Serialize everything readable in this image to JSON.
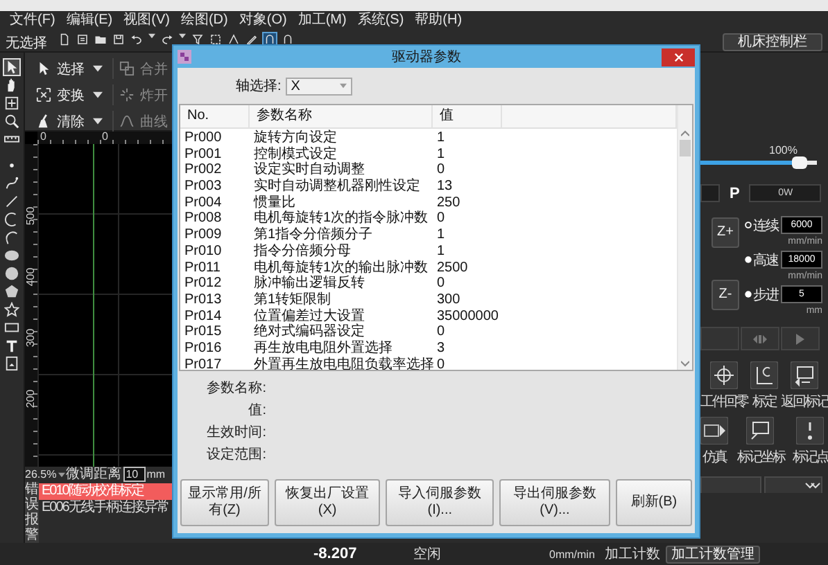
{
  "menu": [
    "文件(F)",
    "编辑(E)",
    "视图(V)",
    "绘图(D)",
    "对象(O)",
    "加工(M)",
    "系统(S)",
    "帮助(H)"
  ],
  "toolbar": {
    "selection": "无选择",
    "machine_panel_button": "机床控制栏"
  },
  "tools": [
    {
      "kind": "pointer",
      "selected": true
    },
    {
      "kind": "hand",
      "selected": false
    },
    {
      "kind": "fit",
      "selected": false
    },
    {
      "kind": "zoom",
      "selected": false
    },
    {
      "kind": "ruler",
      "selected": false
    },
    {
      "kind": "point",
      "selected": false
    },
    {
      "kind": "pen",
      "selected": false
    },
    {
      "kind": "line",
      "selected": false
    },
    {
      "kind": "arc",
      "selected": false
    },
    {
      "kind": "arc2",
      "selected": false
    },
    {
      "kind": "ellipse",
      "selected": false
    },
    {
      "kind": "circle",
      "selected": false
    },
    {
      "kind": "polygon",
      "selected": false
    },
    {
      "kind": "star",
      "selected": false
    },
    {
      "kind": "rect",
      "selected": false
    },
    {
      "kind": "text",
      "selected": false
    },
    {
      "kind": "image",
      "selected": false
    }
  ],
  "ribbon": [
    {
      "kind": "select",
      "label": "选择",
      "disabled": false
    },
    {
      "kind": "transform",
      "label": "变换",
      "disabled": false
    },
    {
      "kind": "clear",
      "label": "清除",
      "disabled": false
    },
    {
      "kind": "merge",
      "label": "合并",
      "disabled": true
    },
    {
      "kind": "explode",
      "label": "炸开",
      "disabled": true
    },
    {
      "kind": "curve",
      "label": "曲线",
      "disabled": true
    }
  ],
  "canvas": {
    "top_ruler": [
      "0",
      "0"
    ],
    "left_ruler": [
      "500",
      "400",
      "300",
      "200"
    ]
  },
  "zoom_bar": {
    "zoom": "26.5%",
    "nudge_label": "微调距离",
    "nudge_value": "10",
    "unit": "mm"
  },
  "alarms": {
    "label": "错误报警",
    "items": [
      {
        "text": "E010随动校准标定",
        "selected": true
      },
      {
        "text": "E006无线手柄连接异常",
        "selected": false
      }
    ]
  },
  "dialog": {
    "title": "驱动器参数",
    "axis_label": "轴选择:",
    "axis_value": "X",
    "columns": [
      "No.",
      "参数名称",
      "值"
    ],
    "rows": [
      {
        "no": "Pr000",
        "name": "旋转方向设定",
        "value": "1"
      },
      {
        "no": "Pr001",
        "name": "控制模式设定",
        "value": "1"
      },
      {
        "no": "Pr002",
        "name": "设定实时自动调整",
        "value": "0"
      },
      {
        "no": "Pr003",
        "name": "实时自动调整机器刚性设定",
        "value": "13"
      },
      {
        "no": "Pr004",
        "name": "惯量比",
        "value": "250"
      },
      {
        "no": "Pr008",
        "name": "电机每旋转1次的指令脉冲数",
        "value": "0"
      },
      {
        "no": "Pr009",
        "name": "第1指令分倍频分子",
        "value": "1"
      },
      {
        "no": "Pr010",
        "name": "指令分倍频分母",
        "value": "1"
      },
      {
        "no": "Pr011",
        "name": "电机每旋转1次的输出脉冲数",
        "value": "2500"
      },
      {
        "no": "Pr012",
        "name": "脉冲输出逻辑反转",
        "value": "0"
      },
      {
        "no": "Pr013",
        "name": "第1转矩限制",
        "value": "300"
      },
      {
        "no": "Pr014",
        "name": "位置偏差过大设置",
        "value": "35000000"
      },
      {
        "no": "Pr015",
        "name": "绝对式编码器设定",
        "value": "0"
      },
      {
        "no": "Pr016",
        "name": "再生放电电阻外置选择",
        "value": "3"
      },
      {
        "no": "Pr017",
        "name": "外置再生放电电阻负载率选择",
        "value": "0"
      }
    ],
    "detail_labels": [
      "参数名称:",
      "值:",
      "生效时间:",
      "设定范围:"
    ],
    "buttons": [
      "显示常用/所有(Z)",
      "恢复出厂设置(X)",
      "导入伺服参数(I)...",
      "导出伺服参数(V)...",
      "刷新(B)"
    ]
  },
  "right_panel": {
    "power": {
      "percent": "100%",
      "level": 0.85,
      "p_label": "P",
      "p_value": "0W"
    },
    "z_buttons": [
      "Z+",
      "Z-"
    ],
    "speed_modes": [
      {
        "label": "连续",
        "value": "6000",
        "unit": "mm/min",
        "selected": true
      },
      {
        "label": "高速",
        "value": "18000",
        "unit": "mm/min",
        "selected": false
      },
      {
        "label": "步进",
        "value": "5",
        "unit": "mm",
        "selected": false
      }
    ],
    "actions": [
      {
        "kind": "home",
        "label": "工件回零"
      },
      {
        "kind": "calibrate",
        "label": "标定"
      },
      {
        "kind": "return",
        "label": "返回标记"
      },
      {
        "kind": "simulate",
        "label": "仿真"
      },
      {
        "kind": "mark",
        "label": "标记坐标"
      },
      {
        "kind": "point",
        "label": "标记点"
      }
    ]
  },
  "status_bar": {
    "coordinate": "-8.207",
    "state": "空闲",
    "speed": "0mm/min",
    "count_label": "加工计数",
    "count_button": "加工计数管理"
  }
}
